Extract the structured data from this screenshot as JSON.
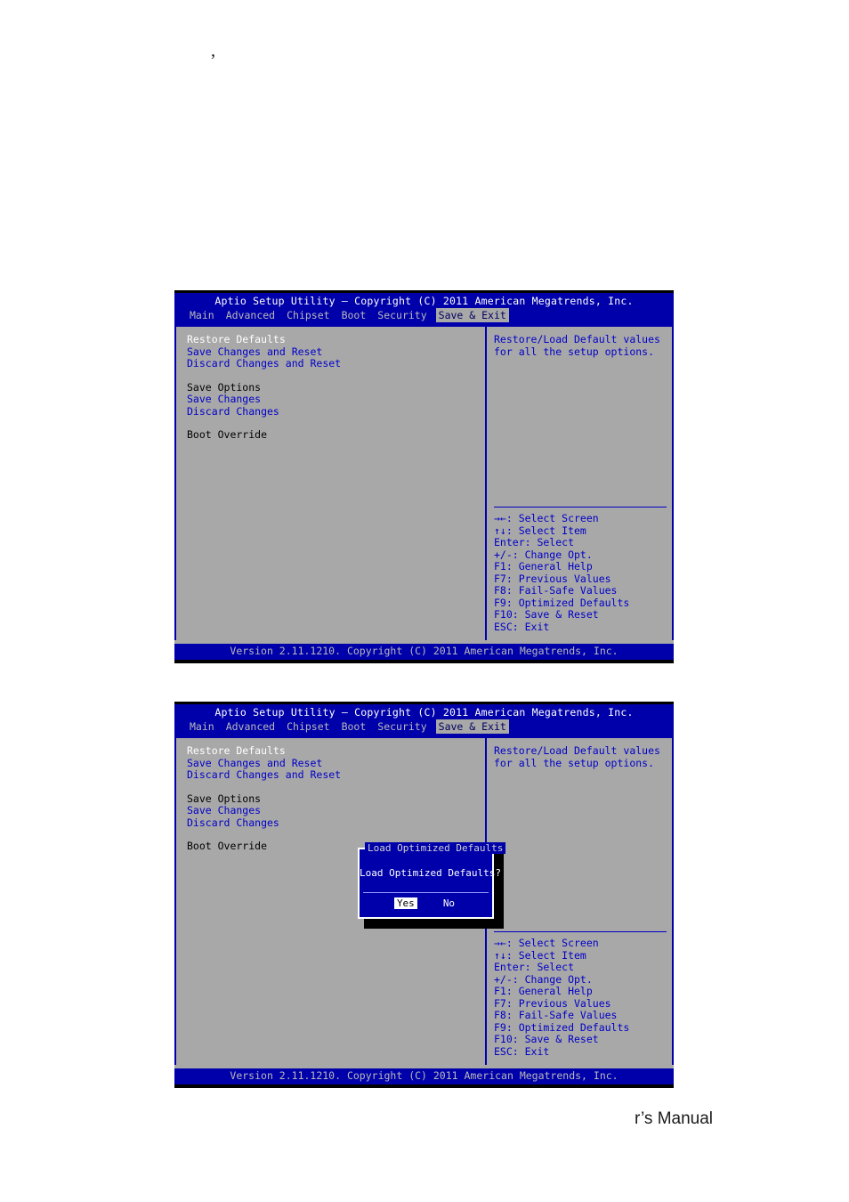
{
  "page": {
    "artifact_mark": "’",
    "footer_text": "r’s Manual"
  },
  "bios": {
    "title": "Aptio Setup Utility – Copyright (C) 2011 American Megatrends, Inc.",
    "footer": "Version 2.11.1210. Copyright (C) 2011 American Megatrends, Inc.",
    "tabs": [
      {
        "label": "Main",
        "active": false
      },
      {
        "label": "Advanced",
        "active": false
      },
      {
        "label": "Chipset",
        "active": false
      },
      {
        "label": "Boot",
        "active": false
      },
      {
        "label": "Security",
        "active": false
      },
      {
        "label": "Save & Exit",
        "active": true
      }
    ],
    "options": [
      {
        "label": "Restore Defaults",
        "state": "selected"
      },
      {
        "label": "Save Changes and Reset",
        "state": "normal"
      },
      {
        "label": "Discard Changes and Reset",
        "state": "normal"
      },
      {
        "label": "",
        "state": "gap"
      },
      {
        "label": "Save Options",
        "state": "header"
      },
      {
        "label": "Save Changes",
        "state": "normal"
      },
      {
        "label": "Discard Changes",
        "state": "normal"
      },
      {
        "label": "",
        "state": "gap"
      },
      {
        "label": "Boot Override",
        "state": "header"
      }
    ],
    "help": [
      "Restore/Load Default values",
      "for all the setup options."
    ],
    "keys": [
      "→←: Select Screen",
      "↑↓: Select Item",
      "Enter: Select",
      "+/-: Change Opt.",
      "F1: General Help",
      "F7: Previous Values",
      "F8: Fail-Safe Values",
      "F9: Optimized Defaults",
      "F10: Save & Reset",
      "ESC: Exit"
    ],
    "colors": {
      "blue_chrome": "#0000aa",
      "body_gray": "#a8a8a8",
      "option_blue": "#0000c8",
      "selected_white": "#ffffff"
    }
  },
  "dialog": {
    "title": "Load Optimized Defaults",
    "message": "Load Optimized Defaults?",
    "buttons": [
      {
        "label": "Yes",
        "active": true
      },
      {
        "label": "No",
        "active": false
      }
    ]
  }
}
